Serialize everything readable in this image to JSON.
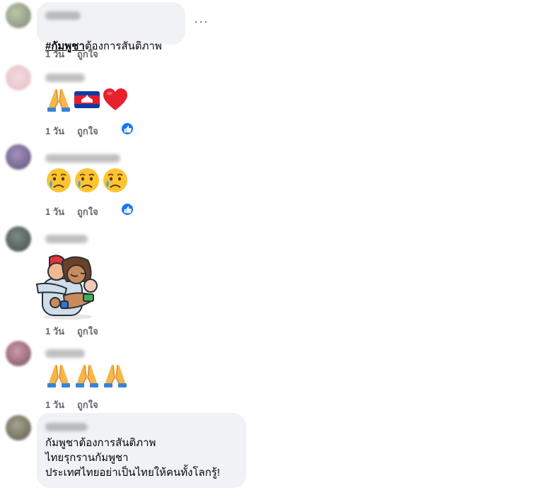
{
  "comments": [
    {
      "hashtag": "#กัมพูชา",
      "text": "ต้องการสันติภาพ",
      "time": "1 วัน",
      "like": "ถูกใจ",
      "more": "···"
    },
    {
      "emojis": [
        "folded-hands",
        "cambodia-flag",
        "red-heart"
      ],
      "time": "1 วัน",
      "like": "ถูกใจ",
      "reaction_icon": "thumbs-up-icon"
    },
    {
      "emojis": [
        "crying-face",
        "crying-face",
        "crying-face"
      ],
      "time": "1 วัน",
      "like": "ถูกใจ",
      "reaction_icon": "thumbs-up-icon"
    },
    {
      "sticker": "hug-sticker",
      "time": "1 วัน",
      "like": "ถูกใจ"
    },
    {
      "emojis": [
        "folded-hands",
        "folded-hands",
        "folded-hands"
      ],
      "time": "1 วัน",
      "like": "ถูกใจ"
    },
    {
      "text": "กัมพูชาต้องการสันติภาพ\nไทยรุกรานกัมพูชา\nประเทศไทยอย่าเป็นไทยให้คนทั้งโลกรู้!"
    }
  ],
  "colors": {
    "bubble": "#f0f2f5",
    "meta": "#65676b",
    "like_blue": "#1877f2"
  }
}
